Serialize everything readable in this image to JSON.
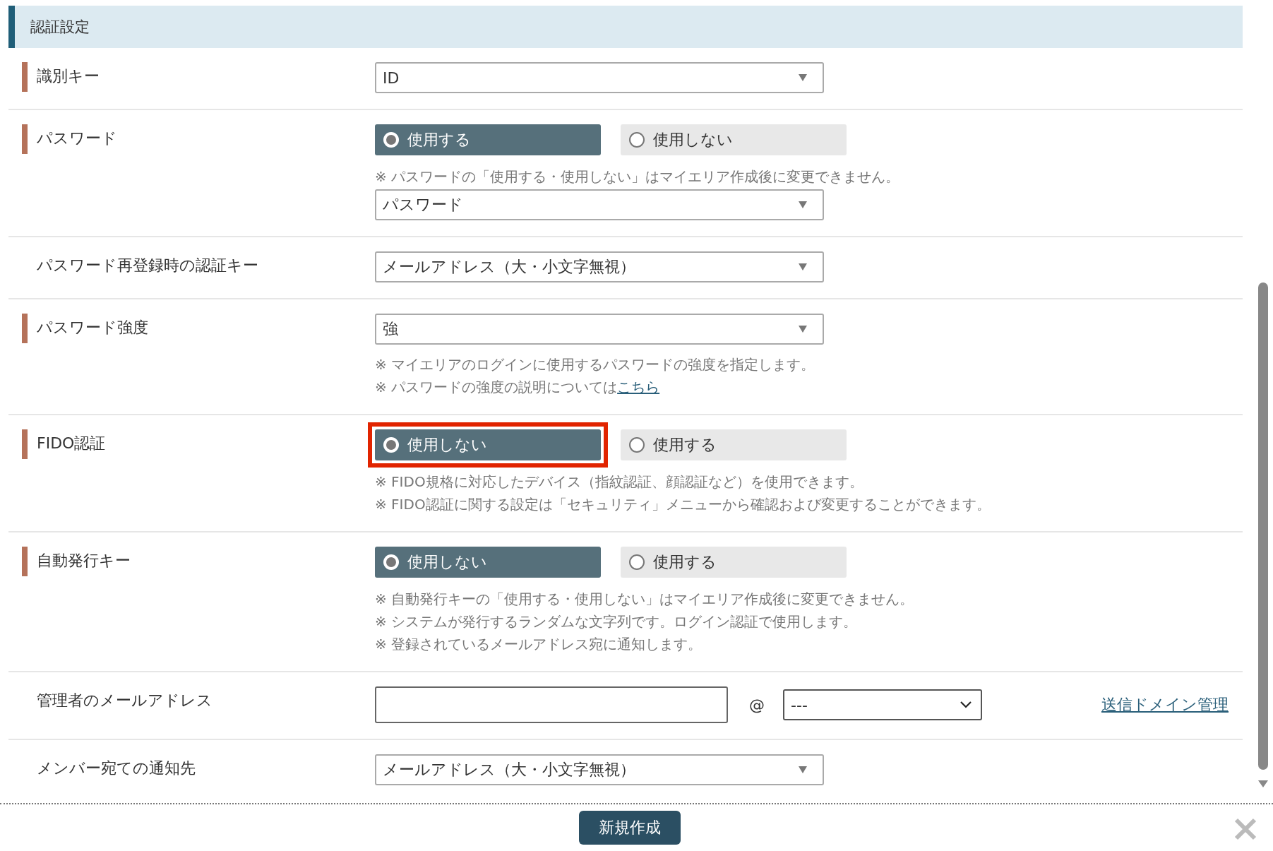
{
  "section": {
    "title": "認証設定"
  },
  "rows": [
    {
      "label": "識別キー",
      "required": true,
      "controls": [
        {
          "kind": "select",
          "value": "ID"
        }
      ]
    },
    {
      "label": "パスワード",
      "required": true,
      "controls": [
        {
          "kind": "radio",
          "options": [
            {
              "label": "使用する",
              "selected": true,
              "highlighted": false
            },
            {
              "label": "使用しない",
              "selected": false,
              "highlighted": false
            }
          ]
        },
        {
          "kind": "note",
          "text": "※ パスワードの「使用する・使用しない」はマイエリア作成後に変更できません。"
        },
        {
          "kind": "select",
          "value": "パスワード"
        }
      ]
    },
    {
      "label": "パスワード再登録時の認証キー",
      "required": false,
      "controls": [
        {
          "kind": "select",
          "value": "メールアドレス（大・小文字無視）"
        }
      ]
    },
    {
      "label": "パスワード強度",
      "required": true,
      "controls": [
        {
          "kind": "select",
          "value": "強"
        },
        {
          "kind": "note",
          "text": "※ マイエリアのログインに使用するパスワードの強度を指定します。"
        },
        {
          "kind": "note",
          "text": "※ パスワードの強度の説明については",
          "link": "こちら"
        }
      ]
    },
    {
      "label": "FIDO認証",
      "required": true,
      "controls": [
        {
          "kind": "radio",
          "options": [
            {
              "label": "使用しない",
              "selected": true,
              "highlighted": true
            },
            {
              "label": "使用する",
              "selected": false,
              "highlighted": false
            }
          ]
        },
        {
          "kind": "note",
          "text": "※ FIDO規格に対応したデバイス（指紋認証、顔認証など）を使用できます。"
        },
        {
          "kind": "note",
          "text": "※ FIDO認証に関する設定は「セキュリティ」メニューから確認および変更することができます。"
        }
      ]
    },
    {
      "label": "自動発行キー",
      "required": true,
      "controls": [
        {
          "kind": "radio",
          "options": [
            {
              "label": "使用しない",
              "selected": true,
              "highlighted": false
            },
            {
              "label": "使用する",
              "selected": false,
              "highlighted": false
            }
          ]
        },
        {
          "kind": "note",
          "text": "※ 自動発行キーの「使用する・使用しない」はマイエリア作成後に変更できません。"
        },
        {
          "kind": "note",
          "text": "※ システムが発行するランダムな文字列です。ログイン認証で使用します。"
        },
        {
          "kind": "note",
          "text": "※ 登録されているメールアドレス宛に通知します。"
        }
      ]
    },
    {
      "label": "管理者のメールアドレス",
      "required": false,
      "controls": [
        {
          "kind": "email",
          "at": "@",
          "domain": "---",
          "link": "送信ドメイン管理"
        }
      ]
    },
    {
      "label": "メンバー宛ての通知先",
      "required": false,
      "controls": [
        {
          "kind": "select",
          "value": "メールアドレス（大・小文字無視）"
        }
      ]
    }
  ],
  "footer": {
    "button": "新規作成"
  }
}
